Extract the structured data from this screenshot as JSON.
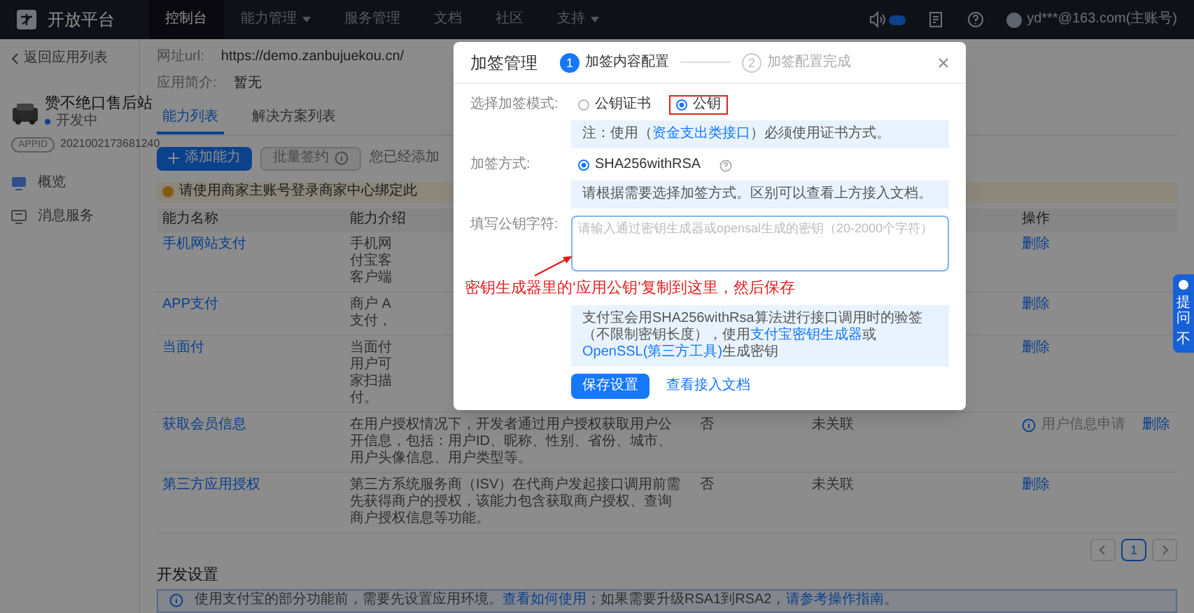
{
  "top_bar": {
    "title": "开放平台",
    "nav": [
      {
        "label": "控制台",
        "selected": true,
        "dropdown": false
      },
      {
        "label": "能力管理",
        "selected": false,
        "dropdown": true
      },
      {
        "label": "服务管理",
        "selected": false,
        "dropdown": false
      },
      {
        "label": "文档",
        "selected": false,
        "dropdown": false
      },
      {
        "label": "社区",
        "selected": false,
        "dropdown": false
      },
      {
        "label": "支持",
        "selected": false,
        "dropdown": true
      }
    ],
    "account": "yd***@163.com(主账号)"
  },
  "sidebar": {
    "back": "返回应用列表",
    "app_name": "赞不绝口售后站",
    "status": "开发中",
    "appid_tag": "APPID",
    "appid": "2021002173681240",
    "items": [
      {
        "label": "概览",
        "kind": "monitor"
      },
      {
        "label": "消息服务",
        "kind": "message"
      }
    ]
  },
  "main": {
    "url_label": "网址url:",
    "url": "https://demo.zanbujuekou.cn/",
    "intro_label": "应用简介:",
    "intro": "暂无",
    "tabs": [
      {
        "label": "能力列表",
        "selected": true
      },
      {
        "label": "解决方案列表",
        "selected": false
      }
    ],
    "add_button": "添加能力",
    "batch_button": {
      "label": "批量签约",
      "disabled": true
    },
    "count_text": "您已经添加",
    "notice": "请使用商家主账号登录商家中心绑定此",
    "columns": [
      {
        "kind": "name",
        "label": "能力名称"
      },
      {
        "kind": "intro",
        "label": "能力介绍"
      },
      {
        "kind": "ops",
        "label": "操作"
      }
    ],
    "rows": [
      {
        "name": "手机网站支付",
        "intro_lines": [
          "手机网",
          "付宝客",
          "客户端"
        ],
        "ops": [
          {
            "kind": "link",
            "label": "删除"
          }
        ]
      },
      {
        "name": "APP支付",
        "intro_lines": [
          "商户 A",
          "支付，"
        ],
        "ops": [
          {
            "kind": "link",
            "label": "删除"
          }
        ]
      },
      {
        "name": "当面付",
        "intro_lines": [
          "当面付",
          "用户可",
          "家扫描",
          "付。"
        ],
        "ops": [
          {
            "kind": "link",
            "label": "删除"
          }
        ]
      },
      {
        "name": "获取会员信息",
        "intro_lines": [
          "在用户授权情况下，开发者通过用户授权获取用户公开信息，包括：用户ID、昵称、性别、省份、城市、用户头像信息、用户类型等。"
        ],
        "column_3": "否",
        "column_4": "未关联",
        "ops": [
          {
            "kind": "info",
            "label": "用户信息申请"
          },
          {
            "kind": "link",
            "label": "删除"
          }
        ]
      },
      {
        "name": "第三方应用授权",
        "intro_lines": [
          "第三方系统服务商（ISV）在代商户发起接口调用前需先获得商户的授权，该能力包含获取商户授权、查询商户授权信息等功能。"
        ],
        "column_3": "否",
        "column_4": "未关联",
        "ops": [
          {
            "kind": "link",
            "label": "删除"
          }
        ]
      }
    ],
    "pages": [
      {
        "label": "1",
        "selected": true
      }
    ],
    "dev_title": "开发设置",
    "dev_notice": [
      {
        "text": "使用支付宝的部分功能前，需要先设置应用环境。",
        "link": false
      },
      {
        "text": "查看如何使用",
        "link": true
      },
      {
        "text": "；如果需要升级RSA1到RSA2，",
        "link": false
      },
      {
        "text": "请参考操作指南",
        "link": true
      },
      {
        "text": "。",
        "link": false
      }
    ]
  },
  "float_tab": {
    "lines": [
      "提问",
      "不"
    ]
  },
  "modal": {
    "title": "加签管理",
    "steps": [
      {
        "number": "1",
        "label": "加签内容配置",
        "selected": true
      },
      {
        "number": "2",
        "label": "加签配置完成",
        "selected": false
      }
    ],
    "mode_label": "选择加签模式:",
    "mode_options": [
      {
        "label": "公钥证书",
        "selected": false,
        "highlighted": false
      },
      {
        "label": "公钥",
        "selected": true,
        "highlighted": true
      }
    ],
    "mode_note": [
      {
        "text": "注：使用（",
        "link": false
      },
      {
        "text": "资金支出类接口",
        "link": true
      },
      {
        "text": "）必须使用证书方式。",
        "link": false
      }
    ],
    "method_label": "加签方式:",
    "method_options": [
      {
        "label": "SHA256withRSA",
        "selected": true
      }
    ],
    "method_note": [
      {
        "text": "请根据需要选择加签方式。区别可以查看上方接入文档。",
        "link": false
      }
    ],
    "key_label": "填写公钥字符:",
    "key_placeholder": "请输入通过密钥生成器或opensal生成的密钥（20-2000个字符）",
    "annotation": "密钥生成器里的‘应用公钥’复制到这里，然后保存",
    "key_note": [
      {
        "text": "支付宝会用SHA256withRsa算法进行接口调用时的验签（不限制密钥长度），使用",
        "link": false
      },
      {
        "text": "支付宝密钥生成器",
        "link": true
      },
      {
        "text": "或",
        "link": false
      },
      {
        "text": "OpenSSL(第三方工具)",
        "link": true
      },
      {
        "text": "生成密钥",
        "link": false
      }
    ],
    "save_button": "保存设置",
    "doc_link": "查看接入文档"
  }
}
